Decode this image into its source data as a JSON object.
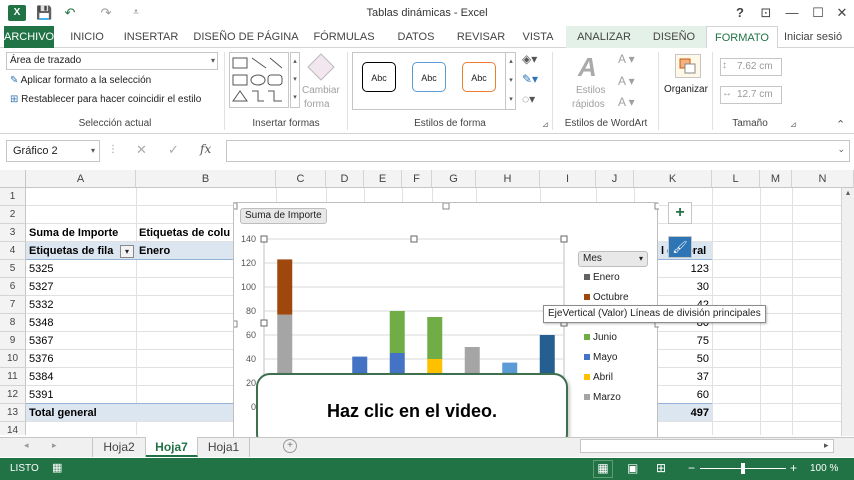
{
  "window": {
    "title": "Tablas dinámicas - Excel",
    "logo": "X",
    "help": "?",
    "ribbon_display": "⊡",
    "minimize": "—",
    "maximize": "☐",
    "close": "✕"
  },
  "qat": {
    "save": "💾",
    "undo": "↶",
    "redo": "↷",
    "customize": "⩡"
  },
  "tabs": [
    "ARCHIVO",
    "INICIO",
    "INSERTAR",
    "DISEÑO DE PÁGINA",
    "FÓRMULAS",
    "DATOS",
    "REVISAR",
    "VISTA",
    "ANALIZAR",
    "DISEÑO",
    "FORMATO",
    "Iniciar sesió"
  ],
  "ribbon": {
    "seleccion": {
      "dropdown_value": "Área de trazado",
      "apply": "Aplicar formato a la selección",
      "reset": "Restablecer para hacer coincidir el estilo",
      "label": "Selección actual"
    },
    "insertar_formas": {
      "change_line1": "Cambiar",
      "change_line2": "forma",
      "label": "Insertar formas"
    },
    "estilos_forma": {
      "abc1": "Abc",
      "abc2": "Abc",
      "abc3": "Abc",
      "label": "Estilos de forma",
      "color_black": "#000000",
      "color_blue": "#5b9bd5",
      "color_orange": "#ed7d31"
    },
    "wordart": {
      "estilos_line1": "Estilos",
      "estilos_line2": "rápidos",
      "label": "Estilos de WordArt"
    },
    "organizar": {
      "label_btn": "Organizar"
    },
    "tamano": {
      "height": "7.62 cm",
      "width": "12.7 cm",
      "label": "Tamaño"
    }
  },
  "formula_bar": {
    "name_box": "Gráfico 2",
    "fx": "fx",
    "cancel": "✕",
    "enter": "✓"
  },
  "columns": [
    "A",
    "B",
    "C",
    "D",
    "E",
    "F",
    "G",
    "H",
    "I",
    "J",
    "K",
    "L",
    "M",
    "N"
  ],
  "rows": [
    "1",
    "2",
    "3",
    "4",
    "5",
    "6",
    "7",
    "8",
    "9",
    "10",
    "11",
    "12",
    "13",
    "14"
  ],
  "cells": {
    "a3": "Suma de Importe",
    "b3": "Etiquetas de colu",
    "a4": "Etiquetas de fila",
    "b4": "Enero",
    "k4": "l general",
    "a5": "5325",
    "a6": "5327",
    "a7": "5332",
    "a8": "5348",
    "a9": "5367",
    "a10": "5376",
    "a11": "5384",
    "a12": "5391",
    "a13": "Total general",
    "k5": "123",
    "k6": "30",
    "k7": "42",
    "k8": "80",
    "k9": "75",
    "k10": "50",
    "k11": "37",
    "k12": "60",
    "k13": "497"
  },
  "chart": {
    "field_button": "Suma de Importe",
    "legend_button": "Mes",
    "tooltip": "EjeVertical (Valor)  Líneas de división principales",
    "video_prompt": "Haz clic en el video.",
    "add_element": "+",
    "style_brush": "🖌"
  },
  "chart_data": {
    "type": "bar",
    "stacked": true,
    "ylim": [
      0,
      140
    ],
    "yticks": [
      "140",
      "120",
      "100",
      "80",
      "60",
      "40",
      "20",
      "0"
    ],
    "categories": [
      "5325",
      "5327",
      "5332",
      "5348",
      "5367",
      "5376",
      "5384",
      "5391"
    ],
    "series": [
      {
        "name": "Marzo",
        "color": "#a5a5a5",
        "values": [
          77,
          0,
          0,
          0,
          0,
          50,
          0,
          0
        ]
      },
      {
        "name": "Abril",
        "color": "#ffc000",
        "values": [
          0,
          0,
          0,
          0,
          40,
          0,
          0,
          0
        ]
      },
      {
        "name": "Mayo",
        "color": "#4472c4",
        "values": [
          0,
          0,
          42,
          45,
          0,
          0,
          0,
          0
        ]
      },
      {
        "name": "Junio",
        "color": "#70ad47",
        "values": [
          0,
          0,
          0,
          35,
          35,
          0,
          0,
          0
        ]
      },
      {
        "name": "Octubre",
        "color": "#9e480e",
        "values": [
          46,
          0,
          0,
          0,
          0,
          0,
          0,
          0
        ]
      },
      {
        "name": "Enero",
        "color": "#636363",
        "values": [
          0,
          0,
          0,
          0,
          0,
          0,
          0,
          0
        ]
      },
      {
        "name": "",
        "color": "#5b9bd5",
        "values": [
          0,
          0,
          0,
          0,
          0,
          0,
          37,
          0
        ]
      },
      {
        "name": "",
        "color": "#255e91",
        "values": [
          0,
          0,
          0,
          0,
          0,
          0,
          0,
          60
        ]
      }
    ],
    "legend_visible": [
      "Enero",
      "Octubre",
      "Junio",
      "Mayo",
      "Abril",
      "Marzo"
    ],
    "grid": true
  },
  "sheet_tabs": [
    "Hoja2",
    "Hoja7",
    "Hoja1"
  ],
  "status": {
    "ready": "LISTO",
    "zoom": "100 %",
    "minus": "−",
    "plus": "+"
  }
}
